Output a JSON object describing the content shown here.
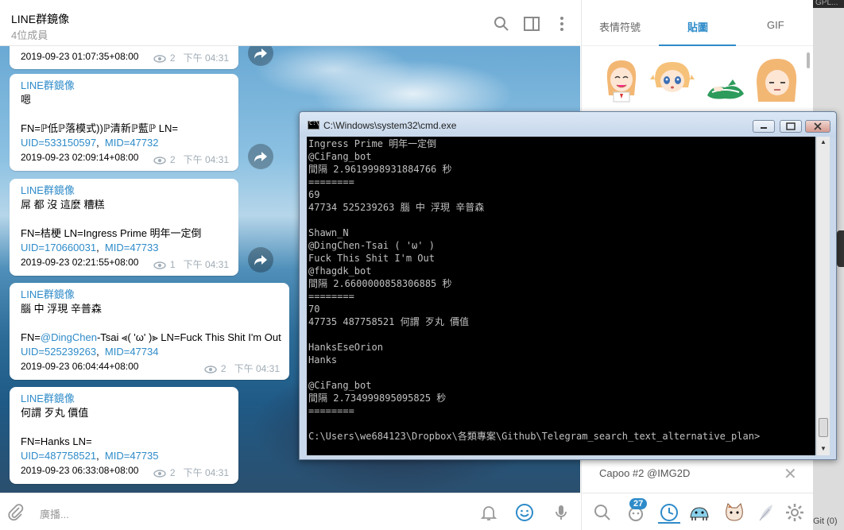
{
  "chat": {
    "title": "LINE群鏡像",
    "members": "4位成員",
    "composer_placeholder": "廣播..."
  },
  "messages": [
    {
      "sender": "",
      "lines": [],
      "date": "2019-09-23 01:07:35+08:00",
      "views": "2",
      "time": "下午 04:31"
    },
    {
      "sender": "LINE群鏡像",
      "lines": [
        "嗯",
        "",
        "FN=ℙ低ℙ落模式))ℙ清新ℙ藍ℙ LN="
      ],
      "uid": "UID=533150597",
      "mid": "MID=47732",
      "date": "2019-09-23 02:09:14+08:00",
      "views": "2",
      "time": "下午 04:31"
    },
    {
      "sender": "LINE群鏡像",
      "lines": [
        "屌 都 沒 這麼 糟糕",
        "",
        "FN=桔梗 LN=Ingress Prime 明年一定倒"
      ],
      "uid": "UID=170660031",
      "mid": "MID=47733",
      "date": "2019-09-23 02:21:55+08:00",
      "views": "1",
      "time": "下午 04:31"
    },
    {
      "sender": "LINE群鏡像",
      "lines": [
        "腦 中 浮現 辛普森",
        ""
      ],
      "fn_prefix": "FN=",
      "fn_mention": "@DingChen",
      "fn_rest": "-Tsai ⪡( 'ω' )⪢ LN=Fuck This Shit I'm Out",
      "uid": "UID=525239263",
      "mid": "MID=47734",
      "date": "2019-09-23 06:04:44+08:00",
      "views": "2",
      "time": "下午 04:31"
    },
    {
      "sender": "LINE群鏡像",
      "lines": [
        "何謂 歹丸 價值",
        "",
        "FN=Hanks LN="
      ],
      "uid": "UID=487758521",
      "mid": "MID=47735",
      "date": "2019-09-23 06:33:08+08:00",
      "views": "2",
      "time": "下午 04:31"
    }
  ],
  "panel": {
    "tabs": [
      "表情符號",
      "貼圖",
      "GIF"
    ],
    "active_tab": "貼圖",
    "sticker_pack": "Capoo #2 @IMG2D",
    "close_symbol": "✕",
    "badge": "27"
  },
  "cmd": {
    "title": "C:\\Windows\\system32\\cmd.exe",
    "lines": [
      "Ingress Prime 明年一定倒",
      "@CiFang_bot",
      "間隔 2.9619998931884766 秒",
      "========",
      "69",
      "47734 525239263 腦 中 浮現 辛普森",
      "",
      "Shawn_N",
      "@DingChen-Tsai  ( 'ω' )",
      "Fuck This Shit I'm Out",
      "@fhagdk_bot",
      "間隔 2.6600000858306885 秒",
      "========",
      "70",
      "47735 487758521 何謂 歹丸 價值",
      "",
      "HanksEseOrion",
      "Hanks",
      "",
      "@CiFang_bot",
      "間隔 2.734999895095825 秒",
      "========",
      "",
      "C:\\Users\\we684123\\Dropbox\\各類專案\\Github\\Telegram_search_text_alternative_plan>"
    ]
  },
  "strip": {
    "top_text": "GPL...",
    "bottom_text": "Git (0)"
  },
  "colors": {
    "accent": "#2e8bc9",
    "console_bg": "#000000",
    "console_fg": "#c0c0c0"
  }
}
